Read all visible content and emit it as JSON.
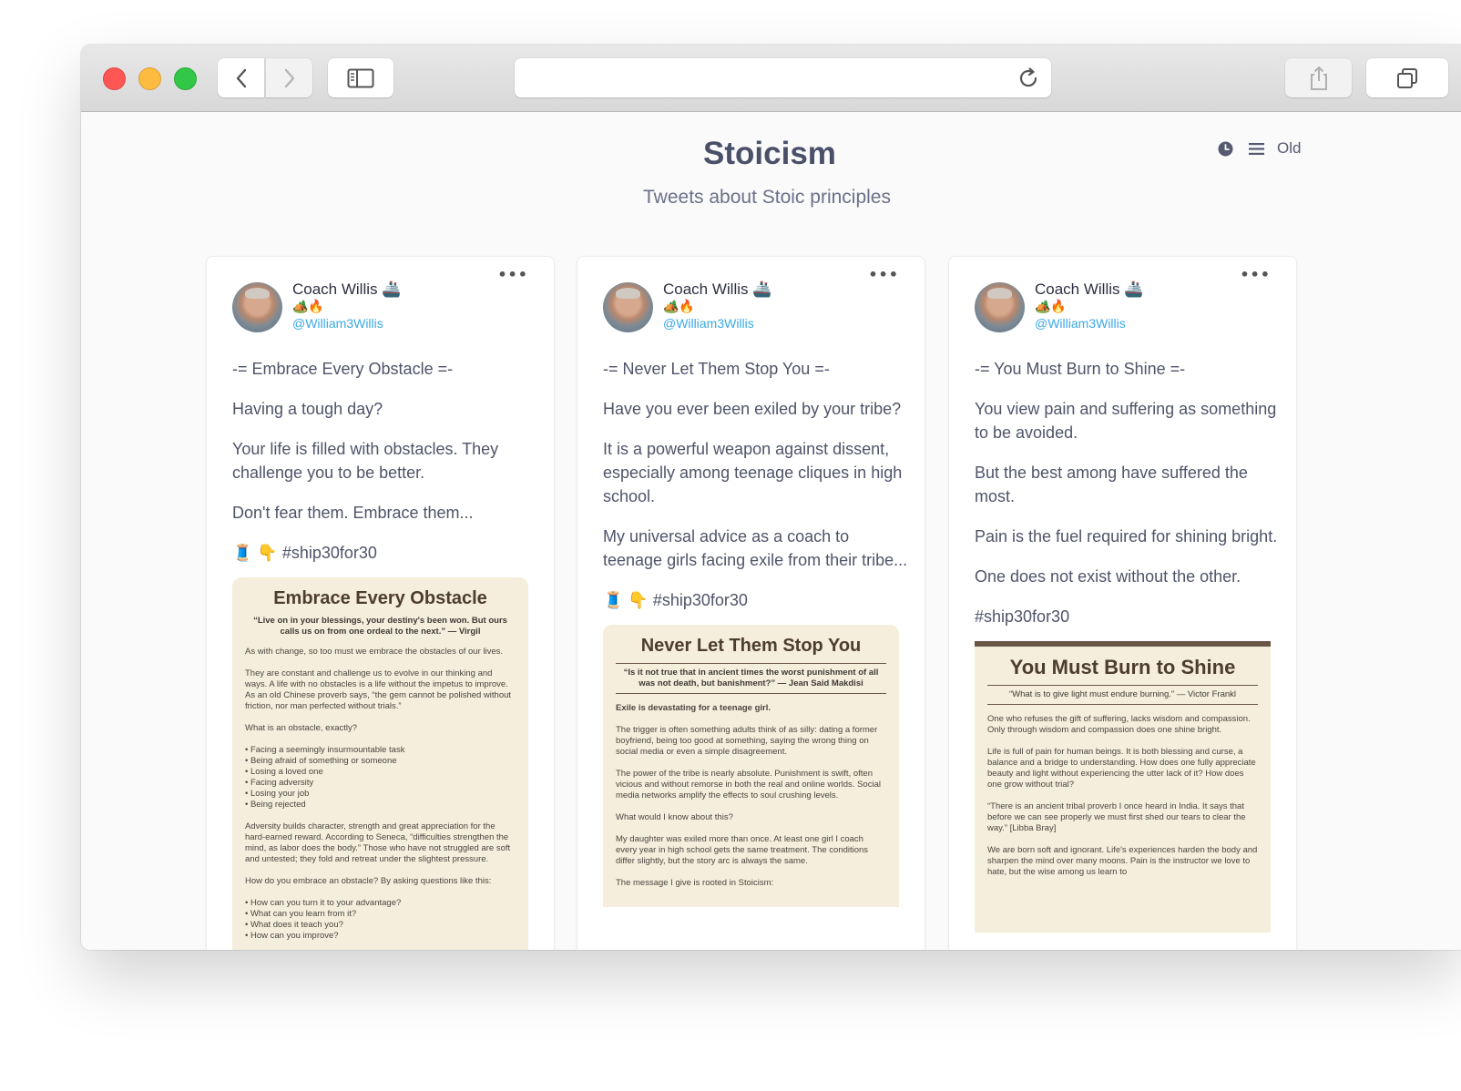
{
  "page": {
    "title": "Stoicism",
    "subtitle": "Tweets about Stoic principles",
    "sort_label": "Old"
  },
  "cards": [
    {
      "author_name": "Coach Willis 🚢",
      "author_emojis": "🏕️🔥",
      "handle": "@William3Willis",
      "paragraphs": [
        "-= Embrace Every Obstacle =-",
        "Having a tough day?",
        "Your life is filled with obstacles. They challenge you to be better.",
        "Don't fear them. Embrace them..."
      ],
      "hashtag_line": "🧵 👇 #ship30for30",
      "poster": {
        "title": "Embrace Every Obstacle",
        "quote": "“Live on in your blessings, your destiny's been won. But ours calls us on from one ordeal to the next.” — Virgil",
        "lines": [
          "As with change, so too must we embrace the obstacles of our lives.",
          "They are constant and challenge us to evolve in our thinking and ways. A life with no obstacles is a life without the impetus to improve. As an old Chinese proverb says, “the gem cannot be polished without friction, nor man perfected without trials.”",
          "What is an obstacle, exactly?",
          "• Facing a seemingly insurmountable task\n• Being afraid of something or someone\n• Losing a loved one\n• Facing adversity\n• Losing your job\n• Being rejected",
          "Adversity builds character, strength and great appreciation for the hard-earned reward. According to Seneca, “difficulties strengthen the mind, as labor does the body.” Those who have not struggled are soft and untested; they fold and retreat under the slightest pressure.",
          "How do you embrace an obstacle? By asking questions like this:",
          "• How can you turn it to your advantage?\n• What can you learn from it?\n• What does it teach you?\n• How can you improve?"
        ]
      }
    },
    {
      "author_name": "Coach Willis 🚢",
      "author_emojis": "🏕️🔥",
      "handle": "@William3Willis",
      "paragraphs": [
        "-= Never Let Them Stop You =-",
        "Have you ever been exiled by your tribe?",
        "It is a powerful weapon against dissent, especially among teenage cliques in high school.",
        "My universal advice as a coach to teenage girls facing exile from their tribe..."
      ],
      "hashtag_line": "🧵 👇 #ship30for30",
      "poster": {
        "title": "Never Let Them Stop You",
        "quote": "“Is it not true that in ancient times the worst punishment of all was not death, but banishment?” — Jean Said Makdisi",
        "lines": [
          "Exile is devastating for a teenage girl.",
          "The trigger is often something adults think of as silly: dating a former boyfriend, being too good at something, saying the wrong thing on social media or even a simple disagreement.",
          "The power of the tribe is nearly absolute. Punishment is swift, often vicious and without remorse in both the real and online worlds. Social media networks amplify the effects to soul crushing levels.",
          "What would I know about this?",
          "My daughter was exiled more than once. At least one girl I coach every year in high school gets the same treatment. The conditions differ slightly, but the story arc is always the same.",
          "The message I give is rooted in Stoicism:"
        ]
      }
    },
    {
      "author_name": "Coach Willis 🚢",
      "author_emojis": "🏕️🔥",
      "handle": "@William3Willis",
      "paragraphs": [
        "-= You Must Burn to Shine =-",
        "You view pain and suffering as something to be avoided.",
        "But the best among have suffered the most.",
        "Pain is the fuel required for shining bright.",
        "One does not exist without the other."
      ],
      "hashtag_line": "#ship30for30",
      "poster": {
        "title": "You Must Burn to Shine",
        "quote": "“What is to give light must endure burning.” — Victor Frankl",
        "lines": [
          "One who refuses the gift of suffering, lacks wisdom and compassion. Only through wisdom and compassion does one shine bright.",
          "Life is full of pain for human beings. It is both blessing and curse, a balance and a bridge to understanding. How does one fully appreciate beauty and light without experiencing the utter lack of it? How does one grow without trial?",
          "“There is an ancient tribal proverb I once heard in India. It says that before we can see properly we must first shed our tears to clear the way.” [Libba Bray]",
          "We are born soft and ignorant. Life's experiences harden the body and sharpen the mind over many moons. Pain is the instructor we love to hate, but the wise among us learn to"
        ]
      }
    }
  ]
}
